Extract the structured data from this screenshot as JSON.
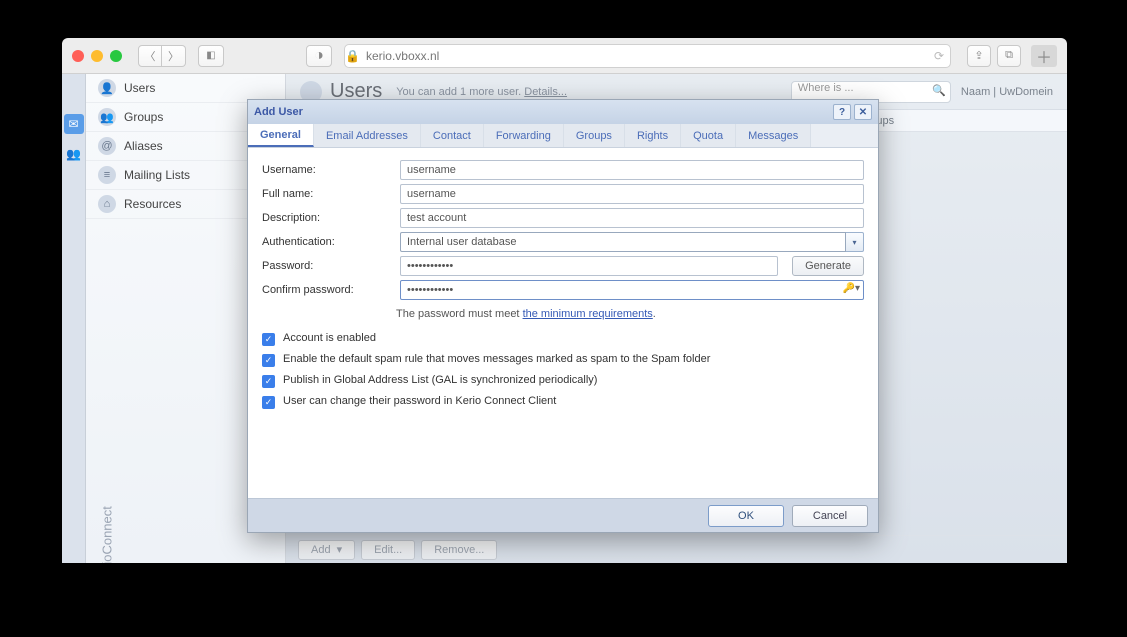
{
  "browser": {
    "url": "kerio.vboxx.nl"
  },
  "brand": "KerioConnect",
  "sidebar": {
    "items": [
      {
        "label": "Users"
      },
      {
        "label": "Groups"
      },
      {
        "label": "Aliases"
      },
      {
        "label": "Mailing Lists"
      },
      {
        "label": "Resources"
      }
    ]
  },
  "header": {
    "title": "Users",
    "blurb_pre": "You can add 1 more user. ",
    "blurb_link": "Details...",
    "search_placeholder": "Where is ...",
    "domain_label": "Naam | UwDomein"
  },
  "columns": {
    "groups": "Groups"
  },
  "toolbar": {
    "add": "Add",
    "edit": "Edit...",
    "remove": "Remove..."
  },
  "dialog": {
    "title": "Add User",
    "tabs": [
      "General",
      "Email Addresses",
      "Contact",
      "Forwarding",
      "Groups",
      "Rights",
      "Quota",
      "Messages"
    ],
    "labels": {
      "username": "Username:",
      "fullname": "Full name:",
      "description": "Description:",
      "authentication": "Authentication:",
      "password": "Password:",
      "confirm": "Confirm password:"
    },
    "values": {
      "username": "username",
      "fullname": "username",
      "description": "test account",
      "authentication": "Internal user database",
      "password": "••••••••••••",
      "confirm": "••••••••••••"
    },
    "generate": "Generate",
    "hint_pre": "The password must meet ",
    "hint_link": "the minimum requirements",
    "hint_post": ".",
    "checks": [
      "Account is enabled",
      "Enable the default spam rule that moves messages marked as spam to the Spam folder",
      "Publish in Global Address List (GAL is synchronized periodically)",
      "User can change their password in Kerio Connect Client"
    ],
    "ok": "OK",
    "cancel": "Cancel"
  }
}
